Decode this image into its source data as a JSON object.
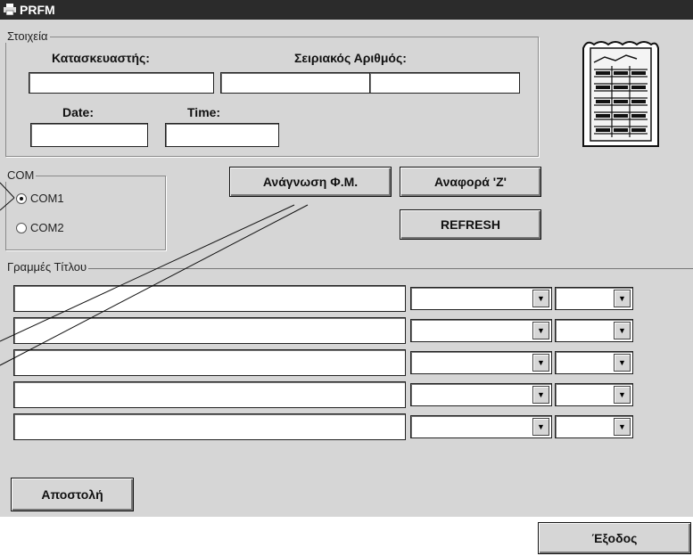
{
  "title": "PRFM",
  "stoixeia": {
    "group_label": "Στοιχεία",
    "manufacturer_label": "Κατασκευαστής:",
    "serial_label": "Σειριακός Αριθμός:",
    "date_label": "Date:",
    "time_label": "Time:"
  },
  "com": {
    "group_label": "COM",
    "options": [
      "COM1",
      "COM2"
    ],
    "selected": "COM1"
  },
  "buttons": {
    "read": "Ανάγνωση Φ.Μ.",
    "report_z": "Αναφορά 'Ζ'",
    "refresh": "REFRESH",
    "send": "Αποστολή",
    "exit": "Έξοδος"
  },
  "lines": {
    "group_label": "Γραμμές Τίτλου",
    "dropdown_glyph": "▼"
  },
  "icons": {
    "titlebar": "printer-icon",
    "document": "receipt-document-icon"
  }
}
